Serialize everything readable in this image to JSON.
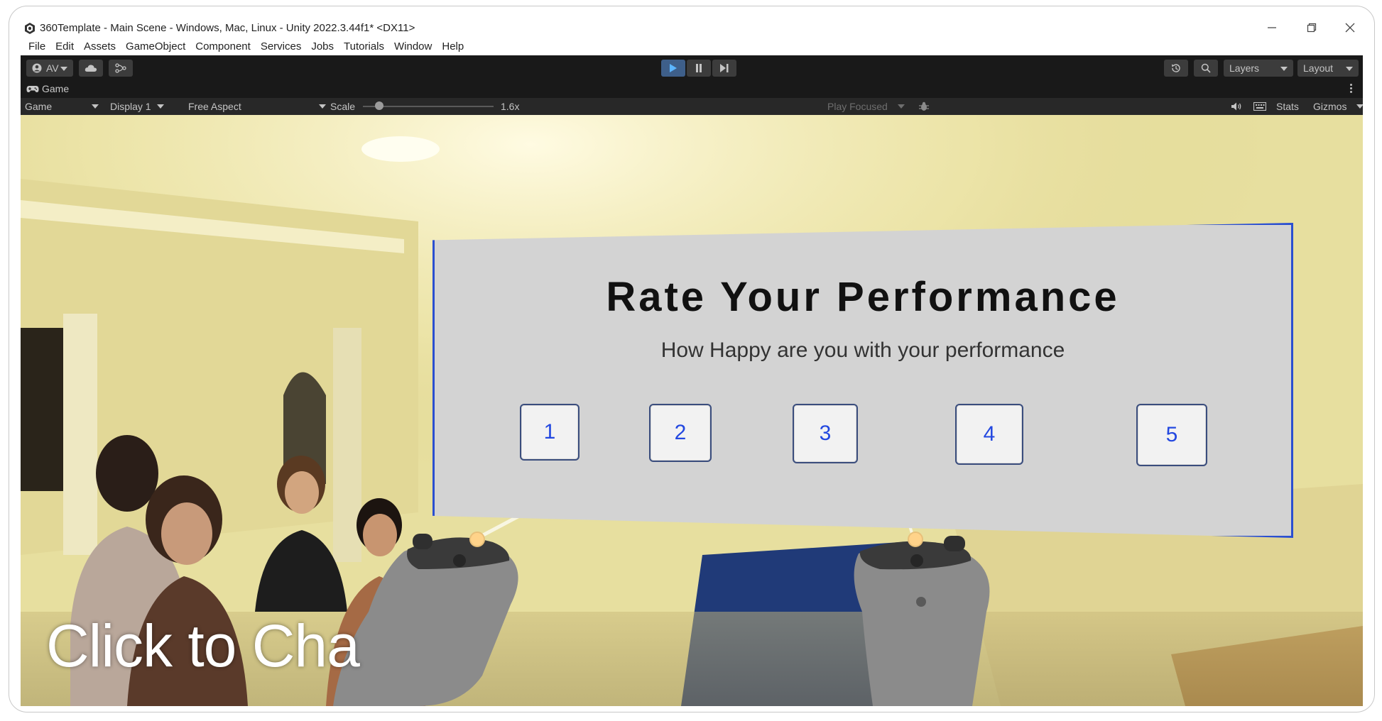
{
  "window": {
    "title": "360Template - Main Scene - Windows, Mac, Linux - Unity 2022.3.44f1* <DX11>"
  },
  "menu": [
    "File",
    "Edit",
    "Assets",
    "GameObject",
    "Component",
    "Services",
    "Jobs",
    "Tutorials",
    "Window",
    "Help"
  ],
  "toolbar": {
    "account_label": "AV",
    "layers_label": "Layers",
    "layout_label": "Layout",
    "play_active": true
  },
  "game_tab": {
    "label": "Game"
  },
  "game_controls": {
    "view_mode": "Game",
    "display": "Display 1",
    "aspect": "Free Aspect",
    "scale_label": "Scale",
    "scale_value": "1.6x",
    "play_mode": "Play Focused",
    "stats_label": "Stats",
    "gizmos_label": "Gizmos"
  },
  "rating_panel": {
    "title": "Rate Your Performance",
    "subtitle": "How Happy are you with your performance",
    "options": [
      "1",
      "2",
      "3",
      "4",
      "5"
    ]
  },
  "overlay": {
    "text": "Click to Cha"
  },
  "colors": {
    "panel_border": "#2b4fd0",
    "button_text": "#2348e0",
    "editor_bg": "#191919",
    "play_active": "#3e5f8a"
  }
}
